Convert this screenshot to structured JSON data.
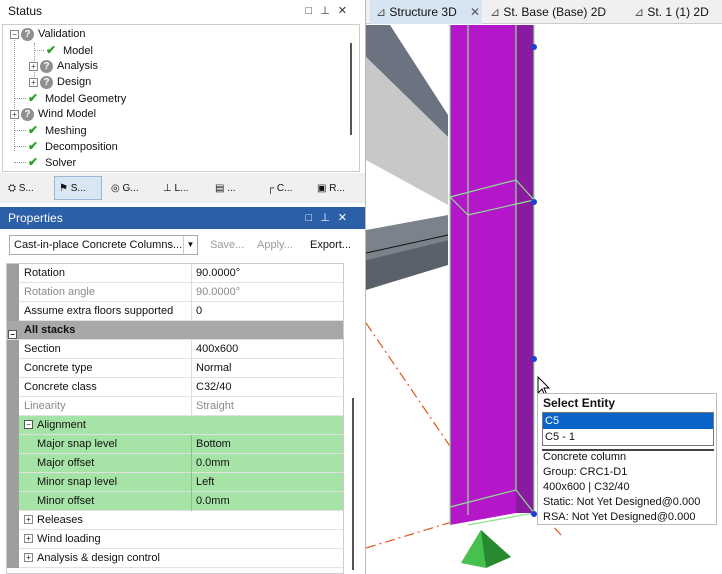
{
  "status_panel": {
    "title": "Status",
    "tree": [
      {
        "label": "Validation",
        "state": "question"
      },
      {
        "label": "Model",
        "state": "ok"
      },
      {
        "label": "Analysis",
        "state": "question"
      },
      {
        "label": "Design",
        "state": "question"
      },
      {
        "label": "Model Geometry",
        "state": "ok"
      },
      {
        "label": "Wind Model",
        "state": "question"
      },
      {
        "label": "Meshing",
        "state": "ok"
      },
      {
        "label": "Decomposition",
        "state": "ok"
      },
      {
        "label": "Solver",
        "state": "ok"
      }
    ],
    "tabs": [
      "S...",
      "S...",
      "G...",
      "L...",
      "...",
      "C...",
      "R..."
    ]
  },
  "properties_panel": {
    "title": "Properties",
    "selector_value": "Cast-in-place Concrete Columns...",
    "save_label": "Save...",
    "apply_label": "Apply...",
    "export_label": "Export...",
    "rows": [
      {
        "name": "Rotation",
        "value": "90.0000°"
      },
      {
        "name": "Rotation angle",
        "value": "90.0000°"
      },
      {
        "name": "Assume extra floors supported",
        "value": "0"
      },
      {
        "name": "All stacks",
        "value": ""
      },
      {
        "name": "Section",
        "value": "400x600"
      },
      {
        "name": "Concrete type",
        "value": "Normal"
      },
      {
        "name": "Concrete class",
        "value": "C32/40"
      },
      {
        "name": "Linearity",
        "value": "Straight"
      },
      {
        "name": "Alignment",
        "value": ""
      },
      {
        "name": "Major snap level",
        "value": "Bottom"
      },
      {
        "name": "Major offset",
        "value": "0.0mm"
      },
      {
        "name": "Minor snap level",
        "value": "Left"
      },
      {
        "name": "Minor offset",
        "value": "0.0mm"
      },
      {
        "name": "Releases",
        "value": ""
      },
      {
        "name": "Wind loading",
        "value": ""
      },
      {
        "name": "Analysis & design control",
        "value": ""
      }
    ]
  },
  "view_tabs": [
    "Structure 3D",
    "St. Base (Base) 2D",
    "St. 1 (1) 2D"
  ],
  "popup": {
    "title": "Select Entity",
    "items": [
      "C5",
      "C5 - 1"
    ],
    "info": [
      "Concrete column",
      "Group: CRC1-D1",
      "400x600 | C32/40",
      "Static: Not Yet Designed@0.000",
      "RSA: Not Yet Designed@0.000"
    ]
  },
  "colors": {
    "column": "#b317c9",
    "accent": "#2b5fa8",
    "highlight": "#a6e3a6",
    "support": "#2fa33a"
  }
}
